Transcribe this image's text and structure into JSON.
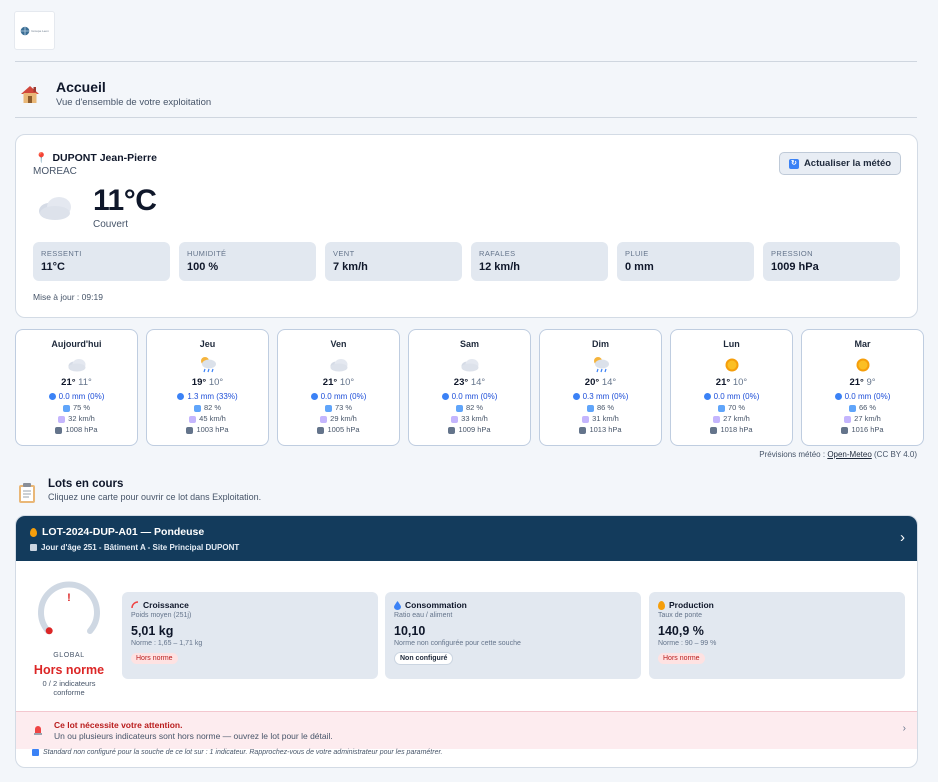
{
  "logo": {
    "text": "Groupe Leon"
  },
  "page": {
    "title": "Accueil",
    "subtitle": "Vue d'ensemble de votre exploitation"
  },
  "weather": {
    "farm_name": "DUPONT Jean-Pierre",
    "city": "MOREAC",
    "refresh_label": "Actualiser la météo",
    "current_temp": "11°C",
    "current_desc": "Couvert",
    "metrics": [
      {
        "label": "RESSENTI",
        "value": "11°C"
      },
      {
        "label": "HUMIDITÉ",
        "value": "100 %"
      },
      {
        "label": "VENT",
        "value": "7 km/h"
      },
      {
        "label": "RAFALES",
        "value": "12 km/h"
      },
      {
        "label": "PLUIE",
        "value": "0 mm"
      },
      {
        "label": "PRESSION",
        "value": "1009 hPa"
      }
    ],
    "updated": "Mise à jour : 09:19"
  },
  "forecast": [
    {
      "day": "Aujourd'hui",
      "icon": "cloud-icon",
      "tmax": "21°",
      "tmin": "11°",
      "rain": "0.0 mm (0%)",
      "humidity": "75 %",
      "wind": "32 km/h",
      "pressure": "1008 hPa"
    },
    {
      "day": "Jeu",
      "icon": "rain-icon",
      "tmax": "19°",
      "tmin": "10°",
      "rain": "1.3 mm (33%)",
      "humidity": "82 %",
      "wind": "45 km/h",
      "pressure": "1003 hPa"
    },
    {
      "day": "Ven",
      "icon": "cloud-icon",
      "tmax": "21°",
      "tmin": "10°",
      "rain": "0.0 mm (0%)",
      "humidity": "73 %",
      "wind": "29 km/h",
      "pressure": "1005 hPa"
    },
    {
      "day": "Sam",
      "icon": "cloud-icon",
      "tmax": "23°",
      "tmin": "14°",
      "rain": "0.0 mm (0%)",
      "humidity": "82 %",
      "wind": "33 km/h",
      "pressure": "1009 hPa"
    },
    {
      "day": "Dim",
      "icon": "rain-icon",
      "tmax": "20°",
      "tmin": "14°",
      "rain": "0.3 mm (0%)",
      "humidity": "86 %",
      "wind": "31 km/h",
      "pressure": "1013 hPa"
    },
    {
      "day": "Lun",
      "icon": "sun-icon",
      "tmax": "21°",
      "tmin": "10°",
      "rain": "0.0 mm (0%)",
      "humidity": "70 %",
      "wind": "27 km/h",
      "pressure": "1018 hPa"
    },
    {
      "day": "Mar",
      "icon": "sun-icon",
      "tmax": "21°",
      "tmin": "9°",
      "rain": "0.0 mm (0%)",
      "humidity": "66 %",
      "wind": "27 km/h",
      "pressure": "1016 hPa"
    }
  ],
  "credit": {
    "prefix": "Prévisions météo :",
    "link": "Open-Meteo",
    "suffix": "(CC BY 4.0)"
  },
  "lots": {
    "title": "Lots en cours",
    "subtitle": "Cliquez une carte pour ouvrir ce lot dans Exploitation.",
    "card": {
      "title": "LOT-2024-DUP-A01 — Pondeuse",
      "subtitle": "Jour d'âge 251 - Bâtiment A - Site Principal DUPONT",
      "gauge": {
        "label": "GLOBAL",
        "status": "Hors norme",
        "count": "0 / 2 indicateurs conforme",
        "level": 0
      },
      "indicators": [
        {
          "title": "Croissance",
          "sub": "Poids moyen (251j)",
          "value": "5,01 kg",
          "norm": "Norme : 1,65 – 1,71 kg",
          "badge": "Hors norme",
          "icon": "growth-icon"
        },
        {
          "title": "Consommation",
          "sub": "Ratio eau / aliment",
          "value": "10,10",
          "norm": "Norme non configurée pour cette souche",
          "badge": "Non configuré",
          "icon": "water-drop-icon"
        },
        {
          "title": "Production",
          "sub": "Taux de ponte",
          "value": "140,9 %",
          "norm": "Norme : 90 – 99 %",
          "badge": "Hors norme",
          "icon": "egg-icon"
        }
      ],
      "alert": {
        "title": "Ce lot nécessite votre attention.",
        "text": "Un ou plusieurs indicateurs sont hors norme — ouvrez le lot pour le détail."
      },
      "footnote": "Standard non configuré pour la souche de ce lot sur : 1 indicateur. Rapprochez-vous de votre administrateur pour les paramétrer."
    }
  },
  "colors": {
    "header": "#133b5c",
    "danger": "#dc2626",
    "accent": "#3b82f6"
  }
}
